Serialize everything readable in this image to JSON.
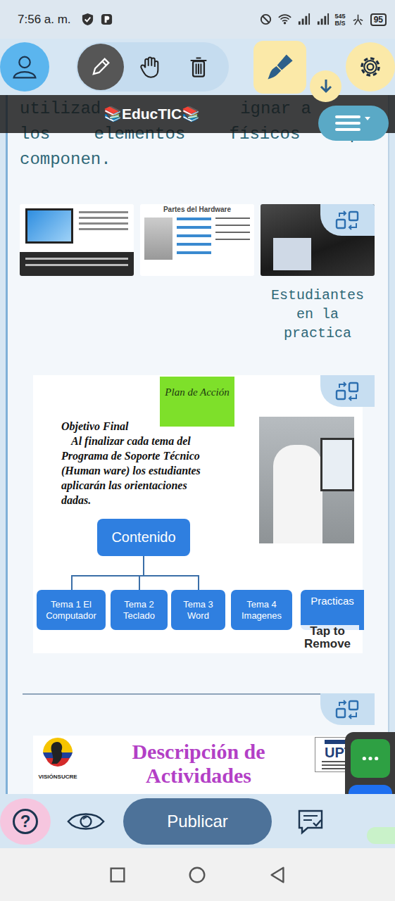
{
  "status_bar": {
    "time": "7:56 a. m.",
    "speed": "545",
    "speed_unit": "B/S",
    "battery": "95"
  },
  "toolbar": {
    "tools": [
      {
        "kind": "pencil",
        "selected": true
      },
      {
        "kind": "hand",
        "selected": false
      },
      {
        "kind": "trash",
        "selected": false
      }
    ]
  },
  "brand": "📚EducTIC📚",
  "paragraph": {
    "first_line": [
      "utilizad",
      "ignar a"
    ],
    "lines": [
      "los elementos físicos que",
      "componen."
    ]
  },
  "gallery": {
    "hardware_title": "Partes del Hardware",
    "caption": "Estudiantes en la practica"
  },
  "slide": {
    "title": "Plan de Acción",
    "objective_title": "Objetivo Final",
    "objective_lines": [
      "Al finalizar cada tema del",
      "Programa de Soporte Técnico",
      "(Human ware) los estudiantes",
      "aplicarán las orientaciones",
      "dadas."
    ],
    "root": "Contenido",
    "topics": [
      {
        "label": "Tema 1 El Computador"
      },
      {
        "label": "Tema 2 Teclado"
      },
      {
        "label": "Tema 3 Word"
      },
      {
        "label": "Tema 4 Imagenes"
      },
      {
        "label": "Practicas"
      }
    ],
    "overlay": "Tap to Remove"
  },
  "banner": {
    "title": "Descripción de Actividades",
    "left_logo": "VISIÓNSUCRE",
    "right_logo": "UPT"
  },
  "bottom_bar": {
    "help": "?",
    "publish": "Publicar"
  }
}
